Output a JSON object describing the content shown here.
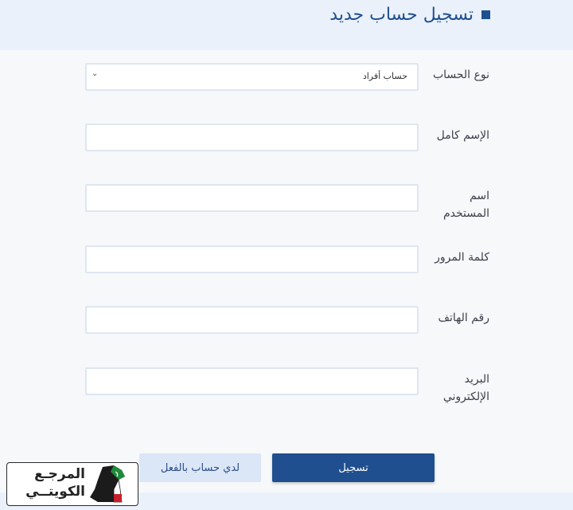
{
  "header": {
    "title": "تسجيل حساب جديد"
  },
  "form": {
    "account_type": {
      "label": "نوع الحساب",
      "selected": "حساب أفراد"
    },
    "full_name": {
      "label": "الإسم كامل",
      "value": ""
    },
    "username": {
      "label": "اسم المستخدم",
      "value": ""
    },
    "password": {
      "label": "كلمة المرور",
      "value": ""
    },
    "phone": {
      "label": "رقم الهاتف",
      "value": ""
    },
    "email": {
      "label": "البريد الإلكتروني",
      "value": ""
    }
  },
  "actions": {
    "register_label": "تسجيل",
    "have_account_label": "لدي حساب بالفعل"
  },
  "watermark": {
    "line1": "المرجـع",
    "line2": "الكويتــي"
  },
  "colors": {
    "primary": "#1f4f8f",
    "secondary_button": "#dbe6f7",
    "header_bg": "#eaf1fb"
  },
  "icons": {
    "select": "chevron-down-icon",
    "title_marker": "square-icon"
  }
}
